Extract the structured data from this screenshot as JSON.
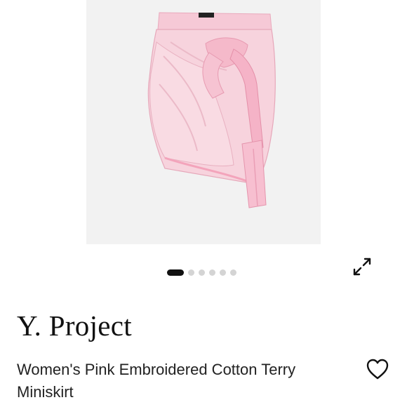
{
  "product": {
    "brand": "Y. Project",
    "title": "Women's Pink Embroidered Cotton Terry Miniskirt"
  },
  "gallery": {
    "image_alt": "pink-terry-wrap-miniskirt",
    "slide_count": 6,
    "active_index": 0
  },
  "actions": {
    "expand_icon": "expand-arrows-icon",
    "favorite_icon": "heart-outline-icon"
  },
  "colors": {
    "image_background": "#f2f2f2",
    "skirt_pink": "#f7c6d4",
    "dot_active": "#111111",
    "dot_inactive": "#d4d4d4",
    "text": "#111111"
  }
}
